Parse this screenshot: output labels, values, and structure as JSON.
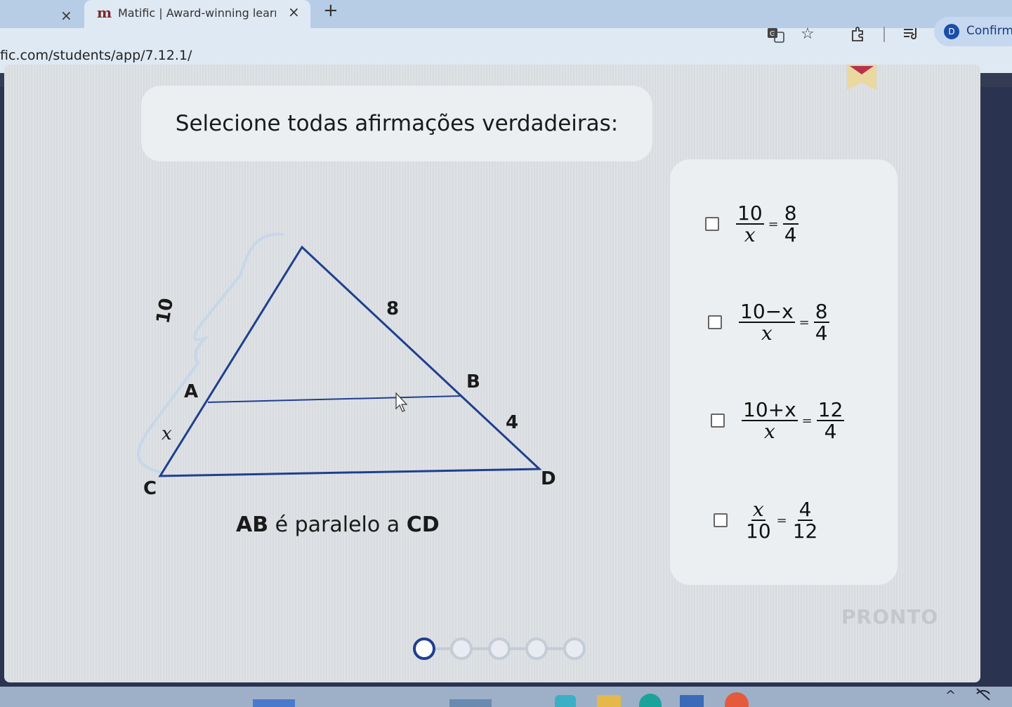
{
  "browser": {
    "tab_title": "Matific | Award-winning learnin",
    "tab_favicon": "m",
    "new_tab_symbol": "+",
    "close_symbol": "×",
    "url": "fic.com/students/app/7.12.1/",
    "confirm_label": "Confirm",
    "confirm_badge": "D"
  },
  "icons": {
    "translate": "translate-icon",
    "star": "star-icon",
    "extensions": "puzzle-icon",
    "reading_list": "reading-list-icon"
  },
  "question": {
    "prompt": "Selecione todas afirmações verdadeiras:"
  },
  "figure": {
    "labels": {
      "A": "A",
      "B": "B",
      "C": "C",
      "D": "D",
      "side_top": "8",
      "side_bottom": "4",
      "left_total": "10",
      "left_lower": "x"
    },
    "note_prefix": "AB",
    "note_middle": " é paralelo a ",
    "note_suffix": "CD"
  },
  "options": [
    {
      "num": "10",
      "den": "x",
      "eq": "=",
      "rnum": "8",
      "rden": "4"
    },
    {
      "num": "10−x",
      "den": "x",
      "eq": "=",
      "rnum": "8",
      "rden": "4"
    },
    {
      "num": "10+x",
      "den": "x",
      "eq": "=",
      "rnum": "12",
      "rden": "4"
    },
    {
      "num": "x",
      "den": "10",
      "eq": "=",
      "rnum": "4",
      "rden": "12"
    }
  ],
  "actions": {
    "done_label": "PRONTO"
  },
  "progress": {
    "steps": 5,
    "current": 1
  },
  "colors": {
    "figure_line": "#1f3f8f",
    "brace": "#c8d6ea",
    "page_bg": "#dcdfe3",
    "card_bg": "#eceff1"
  }
}
